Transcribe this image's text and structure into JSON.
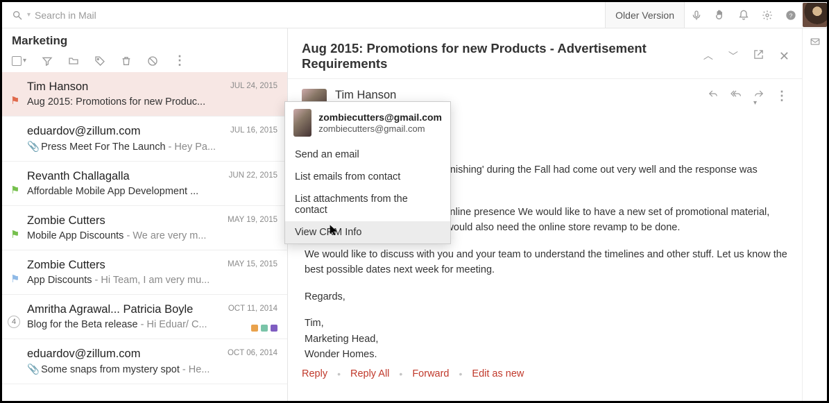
{
  "search": {
    "placeholder": "Search in Mail"
  },
  "older_version": "Older Version",
  "list_title": "Marketing",
  "subject_title": "Aug 2015: Promotions for new Products - Advertisement Requirements",
  "sender_name_header": "Tim Hanson",
  "emails": [
    {
      "sender": "Tim Hanson",
      "date": "JUL 24, 2015",
      "subject": "Aug 2015: Promotions for new Produc...",
      "snippet": "",
      "flag": "#e06a4c",
      "attach": false,
      "selected": true
    },
    {
      "sender": "eduardov@zillum.com",
      "date": "JUL 16, 2015",
      "subject": "Press Meet For The Launch",
      "snippet": " - Hey Pa...",
      "flag": "",
      "attach": true
    },
    {
      "sender": "Revanth Challagalla",
      "date": "JUN 22, 2015",
      "subject": "Affordable Mobile App Development ...",
      "snippet": "",
      "flag": "#76c04d",
      "attach": false
    },
    {
      "sender": "Zombie Cutters",
      "date": "MAY 19, 2015",
      "subject": "Mobile App Discounts",
      "snippet": " - We are very m...",
      "flag": "#76c04d",
      "attach": false
    },
    {
      "sender": "Zombie Cutters",
      "date": "MAY 15, 2015",
      "subject": "App Discounts",
      "snippet": " - Hi Team, I am very mu...",
      "flag": "#8fb9e6",
      "attach": false
    },
    {
      "sender": "Amritha Agrawal... Patricia Boyle",
      "date": "OCT 11, 2014",
      "subject": "Blog for the Beta release",
      "snippet": " - Hi Eduar/ C...",
      "flag": "",
      "attach": false,
      "count": "4",
      "tags": [
        "#e9a24c",
        "#7ac4a8",
        "#7f5dc1"
      ]
    },
    {
      "sender": "eduardov@zillum.com",
      "date": "OCT 06, 2014",
      "subject": "Some snaps from mystery spot",
      "snippet": " - He...",
      "flag": "",
      "attach": true
    }
  ],
  "body": {
    "p1": "Our last campaign for 'Home Furnishing' during the Fall had come out very well and the response was awesome.",
    "p2": "This Fall, we have a revamped online presence We would like to have a new set of promotional material, along with website revamp. We would also need the online store revamp to be done.",
    "p3": "We would like to discuss with you and your team to understand the timelines and other stuff. Let us know the best possible dates next week for meeting.",
    "regards": "Regards,",
    "sig1": "Tim,",
    "sig2": "Marketing Head,",
    "sig3": "Wonder Homes."
  },
  "actions": {
    "reply": "Reply",
    "reply_all": "Reply All",
    "forward": "Forward",
    "edit_as_new": "Edit as new"
  },
  "ctx": {
    "email_bold": "zombiecutters@gmail.com",
    "email_sub": "zombiecutters@gmail.com",
    "send": "Send an email",
    "list_emails": "List emails from contact",
    "list_attach": "List attachments from the contact",
    "view_crm": "View CRM Info"
  }
}
